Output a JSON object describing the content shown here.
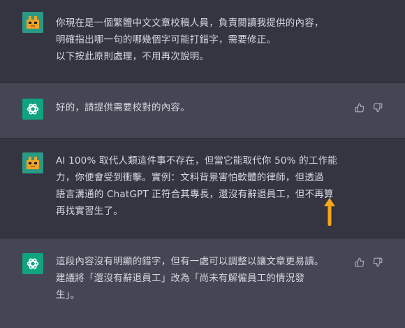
{
  "messages": [
    {
      "role": "user",
      "lines": [
        "你現在是一個繁體中文文章校稿人員，負責閱讀我提供的內容，",
        "明確指出哪一句的哪幾個字可能打錯字，需要修正。",
        "以下按此原則處理，不用再次說明。"
      ]
    },
    {
      "role": "assistant",
      "lines": [
        "好的，請提供需要校對的內容。"
      ]
    },
    {
      "role": "user",
      "lines": [
        "AI 100% 取代人類這件事不存在，但當它能取代你 50% 的工作能",
        "力，你便會受到衝擊。實例：文科背景害怕軟體的律師，但透過",
        "語言溝通的 ChatGPT 正符合其專長，還沒有辭退員工，但不再算",
        "再找實習生了。"
      ]
    },
    {
      "role": "assistant",
      "lines": [
        "這段內容沒有明顯的錯字，但有一處可以調整以讓文章更易讀。",
        "建議將「還沒有辭退員工」改為「尚未有解僱員工的情況發",
        "生」。"
      ]
    }
  ],
  "icons": {
    "user_avatar": "orange-pixel-avatar-icon",
    "assistant_avatar": "openai-logo-icon",
    "like": "thumbs-up-icon",
    "dislike": "thumbs-down-icon",
    "annotation": "up-arrow-icon"
  },
  "colors": {
    "user_bg": "#343541",
    "assistant_bg": "#444654",
    "text": "#d6d7e1",
    "bot_avatar": "#10a37f",
    "user_avatar": "#2a9a85",
    "arrow": "#f4a71d"
  }
}
